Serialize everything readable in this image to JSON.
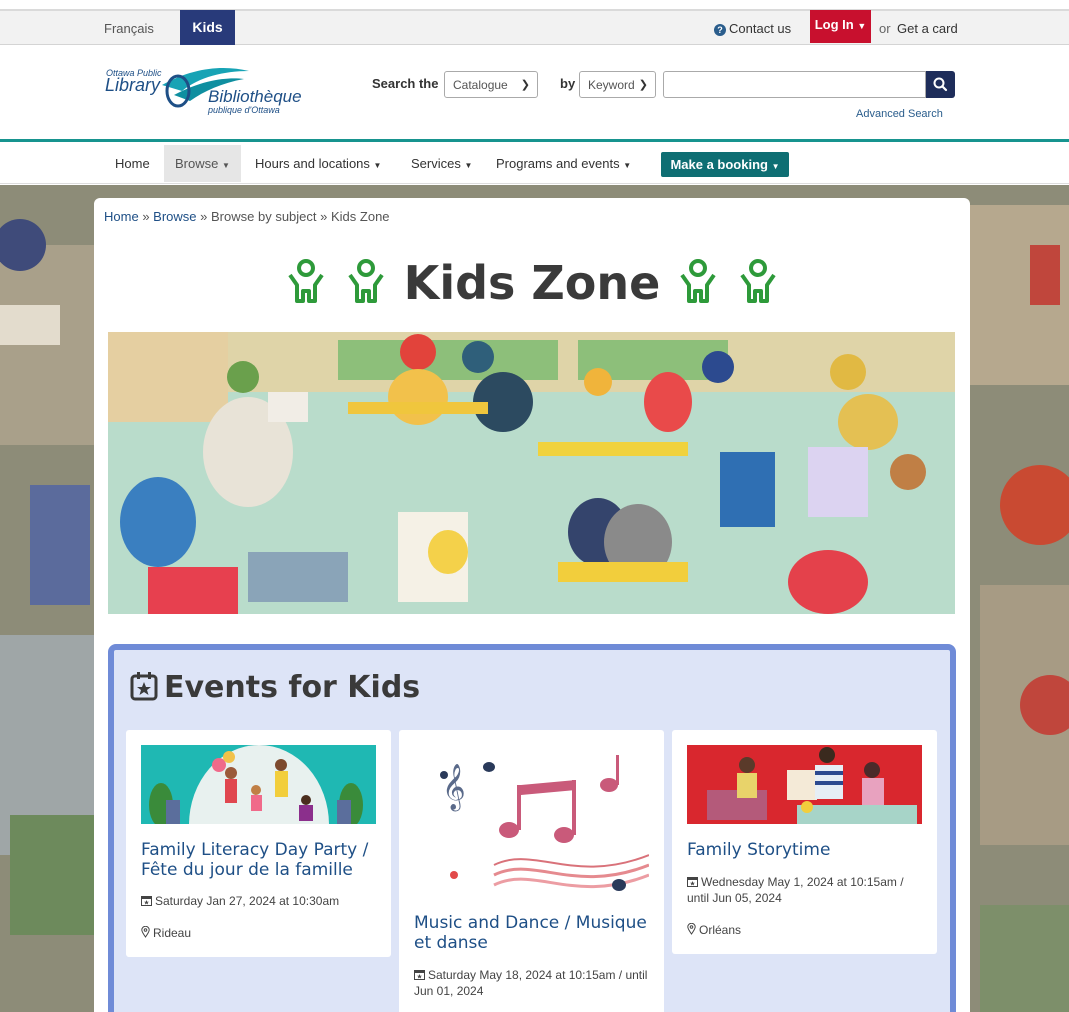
{
  "topbar": {
    "language": "Français",
    "kids": "Kids",
    "contact": "Contact us",
    "login": "Log In",
    "or": "or",
    "get_card": "Get a card"
  },
  "logo": {
    "line1": "Ottawa Public",
    "line2": "Library",
    "line3": "Bibliothèque",
    "line4": "publique d'Ottawa"
  },
  "search": {
    "label_search": "Search the",
    "catalogue_select": "Catalogue",
    "label_by": "by",
    "by_select": "Keyword",
    "query": "",
    "advanced": "Advanced Search"
  },
  "nav": {
    "items": [
      "Home",
      "Browse",
      "Hours and locations",
      "Services",
      "Programs and events"
    ],
    "booking": "Make a booking",
    "active": "Browse"
  },
  "breadcrumb": {
    "home": "Home",
    "browse": "Browse",
    "subject": "Browse by subject",
    "current": "Kids Zone",
    "sep": "»"
  },
  "page": {
    "title": "Kids Zone"
  },
  "events": {
    "heading": "Events for Kids",
    "cards": [
      {
        "title": "Family Literacy Day Party / Fête du jour de la famille",
        "date": "Saturday Jan 27, 2024 at 10:30am",
        "location": "Rideau"
      },
      {
        "title": "Music and Dance / Musique et danse",
        "date": "Saturday May 18, 2024 at 10:15am / until Jun 01, 2024",
        "location": ""
      },
      {
        "title": "Family Storytime",
        "date": "Wednesday May 1, 2024 at 10:15am / until Jun 05, 2024",
        "location": "Orléans"
      }
    ]
  },
  "colors": {
    "kids_badge": "#283a7a",
    "login": "#c8102e",
    "teal": "#17948f",
    "booking": "#0e6e73",
    "events_border": "#6f8bd7",
    "events_bg": "#dde4f7",
    "link": "#1e4f86",
    "kid_icon": "#2e9a3a"
  }
}
